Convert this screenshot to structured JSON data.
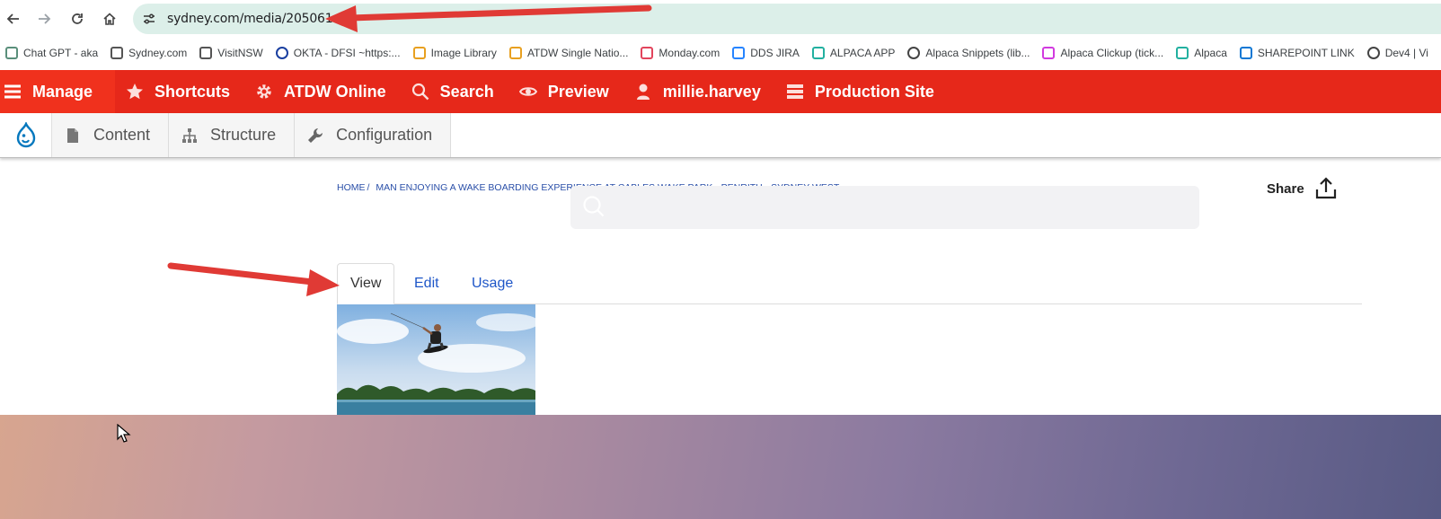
{
  "browser": {
    "url": "sydney.com/media/205061",
    "nav_icons": [
      "back-arrow-icon",
      "forward-arrow-icon",
      "reload-icon",
      "home-icon",
      "site-info-icon"
    ]
  },
  "bookmarks": [
    {
      "label": "Chat GPT - aka",
      "icon": "chatgpt-icon",
      "color": "#5a8f7b"
    },
    {
      "label": "Sydney.com",
      "icon": "sydney-icon",
      "color": "#555555"
    },
    {
      "label": "VisitNSW",
      "icon": "visitnsw-icon",
      "color": "#555555"
    },
    {
      "label": "OKTA - DFSI ~https:...",
      "icon": "okta-icon",
      "color": "#1a3fa0"
    },
    {
      "label": "Image Library",
      "icon": "image-library-icon",
      "color": "#e8a020"
    },
    {
      "label": "ATDW Single Natio...",
      "icon": "atdw-icon",
      "color": "#e8a020"
    },
    {
      "label": "Monday.com",
      "icon": "monday-icon",
      "color": "#e2445c"
    },
    {
      "label": "DDS JIRA",
      "icon": "jira-icon",
      "color": "#2684ff"
    },
    {
      "label": "ALPACA APP",
      "icon": "alpaca-icon",
      "color": "#22b0a0"
    },
    {
      "label": "Alpaca Snippets (lib...",
      "icon": "globe-icon",
      "color": "#444444"
    },
    {
      "label": "Alpaca Clickup (tick...",
      "icon": "clickup-icon",
      "color": "#d13adf"
    },
    {
      "label": "Alpaca",
      "icon": "alpaca-icon",
      "color": "#22b0a0"
    },
    {
      "label": "SHAREPOINT LINK",
      "icon": "onedrive-icon",
      "color": "#0f78d4"
    },
    {
      "label": "Dev4 | Vi",
      "icon": "globe-icon",
      "color": "#444444"
    }
  ],
  "toolbar": {
    "color": "#e6281a",
    "items": [
      {
        "label": "Manage",
        "icon": "hamburger-icon"
      },
      {
        "label": "Shortcuts",
        "icon": "star-icon"
      },
      {
        "label": "ATDW Online",
        "icon": "gear-icon"
      },
      {
        "label": "Search",
        "icon": "search-icon"
      },
      {
        "label": "Preview",
        "icon": "eye-icon"
      },
      {
        "label": "millie.harvey",
        "icon": "user-icon"
      },
      {
        "label": "Production Site",
        "icon": "server-icon"
      }
    ]
  },
  "tray": {
    "items": [
      {
        "label": "Content",
        "icon": "document-icon"
      },
      {
        "label": "Structure",
        "icon": "sitemap-icon"
      },
      {
        "label": "Configuration",
        "icon": "wrench-icon"
      }
    ]
  },
  "page": {
    "breadcrumb_home": "HOME",
    "breadcrumb_current": "MAN ENJOYING A WAKE BOARDING EXPERIENCE AT CABLES WAKE PARK - PENRITH - SYDNEY WEST",
    "share_label": "Share",
    "tabs": [
      "View",
      "Edit",
      "Usage"
    ],
    "active_tab": "View"
  }
}
